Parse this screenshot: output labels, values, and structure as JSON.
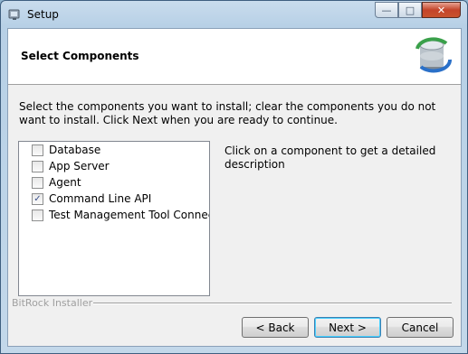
{
  "window": {
    "title": "Setup"
  },
  "header": {
    "title": "Select Components"
  },
  "instruction": "Select the components you want to install; clear the components you do not want to install. Click Next when you are ready to continue.",
  "components": [
    {
      "label": "Database",
      "checked": false
    },
    {
      "label": "App Server",
      "checked": false
    },
    {
      "label": "Agent",
      "checked": false
    },
    {
      "label": "Command Line API",
      "checked": true
    },
    {
      "label": "Test Management Tool Connector",
      "checked": false
    }
  ],
  "description": "Click on a component to get a detailed description",
  "footer": {
    "brand": "BitRock Installer"
  },
  "buttons": {
    "back": "< Back",
    "next": "Next >",
    "cancel": "Cancel"
  }
}
